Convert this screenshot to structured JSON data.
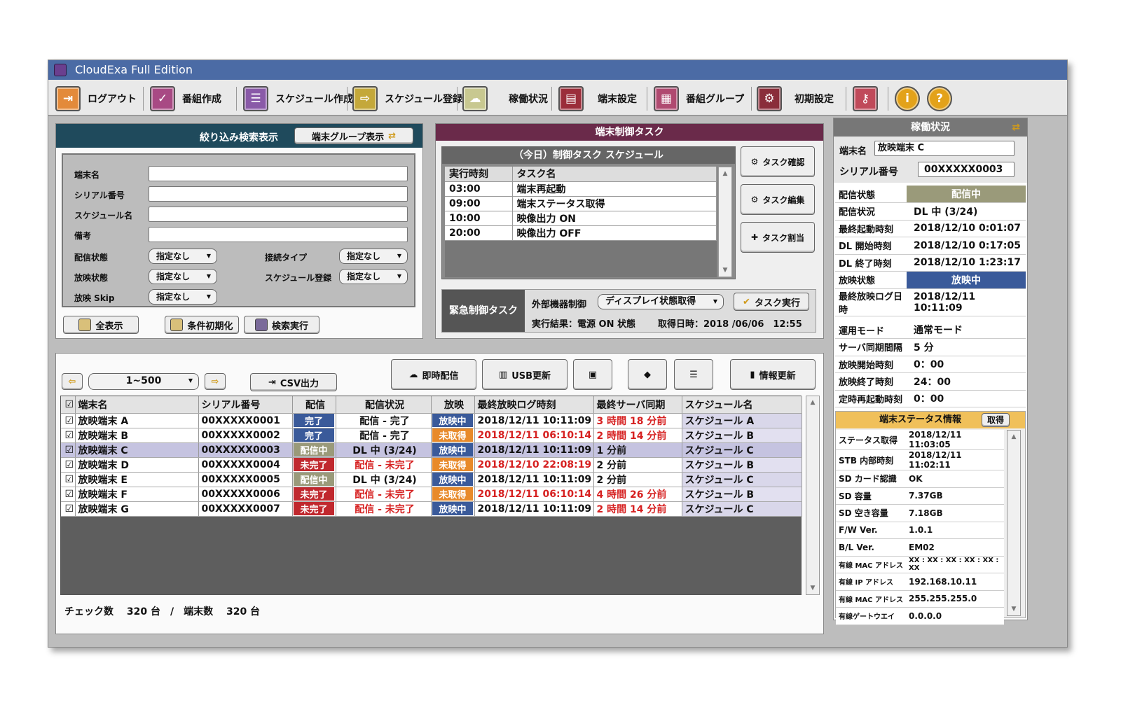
{
  "title": "CloudExa Full Edition",
  "toolbar": [
    {
      "label": "ログアウト",
      "icon": "logout-icon",
      "color": "#e38a3a"
    },
    {
      "label": "番組作成",
      "icon": "program-create-icon",
      "color": "#a84a84"
    },
    {
      "label": "スケジュール作成",
      "icon": "schedule-create-icon",
      "color": "#8a5aa8"
    },
    {
      "label": "スケジュール登録",
      "icon": "schedule-register-icon",
      "color": "#c4a83a"
    },
    {
      "label": "稼働状況",
      "icon": "status-icon",
      "color": "#c8c890"
    },
    {
      "label": "端末設定",
      "icon": "terminal-settings-icon",
      "color": "#9b2d3a"
    },
    {
      "label": "番組グループ",
      "icon": "program-group-icon",
      "color": "#b04a70"
    },
    {
      "label": "初期設定",
      "icon": "initial-settings-icon",
      "color": "#8a2d3a"
    }
  ],
  "toolbar_extra": [
    {
      "icon": "key-icon",
      "glyph": "⚷",
      "color": "#c04a5a"
    },
    {
      "icon": "info-icon",
      "glyph": "i",
      "color": "#e3a21a"
    },
    {
      "icon": "help-icon",
      "glyph": "?",
      "color": "#e3a21a"
    }
  ],
  "search": {
    "header": "絞り込み検索表示",
    "group_button": "端末グループ表示",
    "fields": [
      "端末名",
      "シリアル番号",
      "スケジュール名",
      "備考"
    ],
    "delivery_state_label": "配信状態",
    "delivery_state_value": "指定なし",
    "play_state_label": "放映状態",
    "play_state_value": "指定なし",
    "skip_label": "放映 Skip",
    "skip_value": "指定なし",
    "connect_type_label": "接続タイプ",
    "connect_type_value": "指定なし",
    "schedule_reg_label": "スケジュール登録",
    "schedule_reg_value": "指定なし",
    "show_all": "全表示",
    "reset": "条件初期化",
    "execute": "検索実行"
  },
  "control": {
    "header": "端末制御タスク",
    "today_header": "（今日）制御タスク スケジュール",
    "col_time": "実行時刻",
    "col_task": "タスク名",
    "tasks": [
      {
        "time": "03:00",
        "name": "端末再起動"
      },
      {
        "time": "09:00",
        "name": "端末ステータス取得"
      },
      {
        "time": "10:00",
        "name": "映像出力 ON"
      },
      {
        "time": "20:00",
        "name": "映像出力 OFF"
      }
    ],
    "btn_confirm": "タスク確認",
    "btn_edit": "タスク編集",
    "btn_assign": "タスク割当",
    "urgent_label": "緊急制御タスク",
    "ext_label": "外部機器制御",
    "ext_value": "ディスプレイ状態取得",
    "exec_button": "タスク実行",
    "result": "実行結果：電源 ON 状態",
    "fetched": "取得日時：2018 /06/06　12:55"
  },
  "list": {
    "range": "1~500",
    "csv": "CSV出力",
    "btn_instant": "即時配信",
    "btn_usb": "USB更新",
    "btn_refresh": "情報更新",
    "columns": [
      "端末名",
      "シリアル番号",
      "配信",
      "配信状況",
      "放映",
      "最終放映ログ時刻",
      "最終サーバ同期",
      "スケジュール名"
    ],
    "rows": [
      {
        "name": "放映端末 A",
        "serial": "00XXXXX0001",
        "dl": "完了",
        "dlc": "#3a5a9a",
        "dls": "配信 - 完了",
        "dlsred": false,
        "play": "放映中",
        "pc": "#3a5a9a",
        "log": "2018/12/11 10:11:09",
        "logred": false,
        "sync": "3 時間 18 分前",
        "syncred": true,
        "sched": "スケジュール A"
      },
      {
        "name": "放映端末 B",
        "serial": "00XXXXX0002",
        "dl": "完了",
        "dlc": "#3a5a9a",
        "dls": "配信 - 完了",
        "dlsred": false,
        "play": "未取得",
        "pc": "#e88a2a",
        "log": "2018/12/11 06:10:14",
        "logred": true,
        "sync": "2 時間 14 分前",
        "syncred": true,
        "sched": "スケジュール B"
      },
      {
        "name": "放映端末 C",
        "serial": "00XXXXX0003",
        "dl": "配信中",
        "dlc": "#9a9a7a",
        "dls": "DL 中 (3/24)",
        "dlsred": false,
        "play": "放映中",
        "pc": "#3a5a9a",
        "log": "2018/12/11 10:11:09",
        "logred": false,
        "sync": "1 分前",
        "syncred": false,
        "sched": "スケジュール C"
      },
      {
        "name": "放映端末 D",
        "serial": "00XXXXX0004",
        "dl": "未完了",
        "dlc": "#c0282e",
        "dls": "配信 - 未完了",
        "dlsred": true,
        "play": "未取得",
        "pc": "#e88a2a",
        "log": "2018/12/10 22:08:19",
        "logred": true,
        "sync": "2 分前",
        "syncred": false,
        "sched": "スケジュール B"
      },
      {
        "name": "放映端末 E",
        "serial": "00XXXXX0005",
        "dl": "配信中",
        "dlc": "#9a9a7a",
        "dls": "DL 中 (3/24)",
        "dlsred": false,
        "play": "放映中",
        "pc": "#3a5a9a",
        "log": "2018/12/11 10:11:09",
        "logred": false,
        "sync": "2 分前",
        "syncred": false,
        "sched": "スケジュール C"
      },
      {
        "name": "放映端末 F",
        "serial": "00XXXXX0006",
        "dl": "未完了",
        "dlc": "#c0282e",
        "dls": "配信 - 未完了",
        "dlsred": true,
        "play": "未取得",
        "pc": "#e88a2a",
        "log": "2018/12/11 06:10:14",
        "logred": true,
        "sync": "4 時間 26 分前",
        "syncred": true,
        "sched": "スケジュール B"
      },
      {
        "name": "放映端末 G",
        "serial": "00XXXXX0007",
        "dl": "未完了",
        "dlc": "#c0282e",
        "dls": "配信 - 未完了",
        "dlsred": true,
        "play": "放映中",
        "pc": "#3a5a9a",
        "log": "2018/12/11 10:11:09",
        "logred": false,
        "sync": "2 時間 14 分前",
        "syncred": true,
        "sched": "スケジュール C"
      }
    ],
    "footer": "チェック数　 320 台　/　端末数　 320 台"
  },
  "status": {
    "header": "稼働状況",
    "name_label": "端末名",
    "name_value": "放映端末 C",
    "serial_label": "シリアル番号",
    "serial_value": "00XXXXX0003",
    "rows1": [
      {
        "k": "配信状態",
        "v": "配信中",
        "badge": "#9a9a7a"
      },
      {
        "k": "配信状況",
        "v": "DL 中 (3/24)"
      },
      {
        "k": "最終起動時刻",
        "v": "2018/12/10 0:01:07"
      },
      {
        "k": "DL 開始時刻",
        "v": "2018/12/10 0:17:05"
      },
      {
        "k": "DL 終了時刻",
        "v": "2018/12/10 1:23:17"
      },
      {
        "k": "放映状態",
        "v": "放映中",
        "badge": "#3a5a9a"
      },
      {
        "k": "最終放映ログ日時",
        "v": "2018/12/11 10:11:09"
      }
    ],
    "rows2": [
      {
        "k": "運用モード",
        "v": "通常モード"
      },
      {
        "k": "サーバ同期間隔",
        "v": "5 分"
      },
      {
        "k": "放映開始時刻",
        "v": "0：00"
      },
      {
        "k": "放映終了時刻",
        "v": "24：00"
      },
      {
        "k": "定時再起動時刻",
        "v": "0：00"
      }
    ],
    "st_header": "端末ステータス情報",
    "st_button": "取得",
    "st_rows": [
      {
        "k": "ステータス取得",
        "v": "2018/12/11 11:03:05"
      },
      {
        "k": "STB 内部時刻",
        "v": "2018/12/11 11:02:11"
      },
      {
        "k": "SD カード認識",
        "v": "OK"
      },
      {
        "k": "SD 容量",
        "v": "7.37GB"
      },
      {
        "k": "SD 空き容量",
        "v": "7.18GB"
      },
      {
        "k": "F/W Ver.",
        "v": "1.0.1"
      },
      {
        "k": "B/L Ver.",
        "v": "EM02"
      },
      {
        "k": "有線 MAC アドレス",
        "v": "XX : XX : XX : XX : XX : XX"
      },
      {
        "k": "有線 IP アドレス",
        "v": "192.168.10.11"
      },
      {
        "k": "有線 MAC アドレス",
        "v": "255.255.255.0"
      },
      {
        "k": "有線ゲートウエイ",
        "v": "0.0.0.0"
      }
    ]
  }
}
